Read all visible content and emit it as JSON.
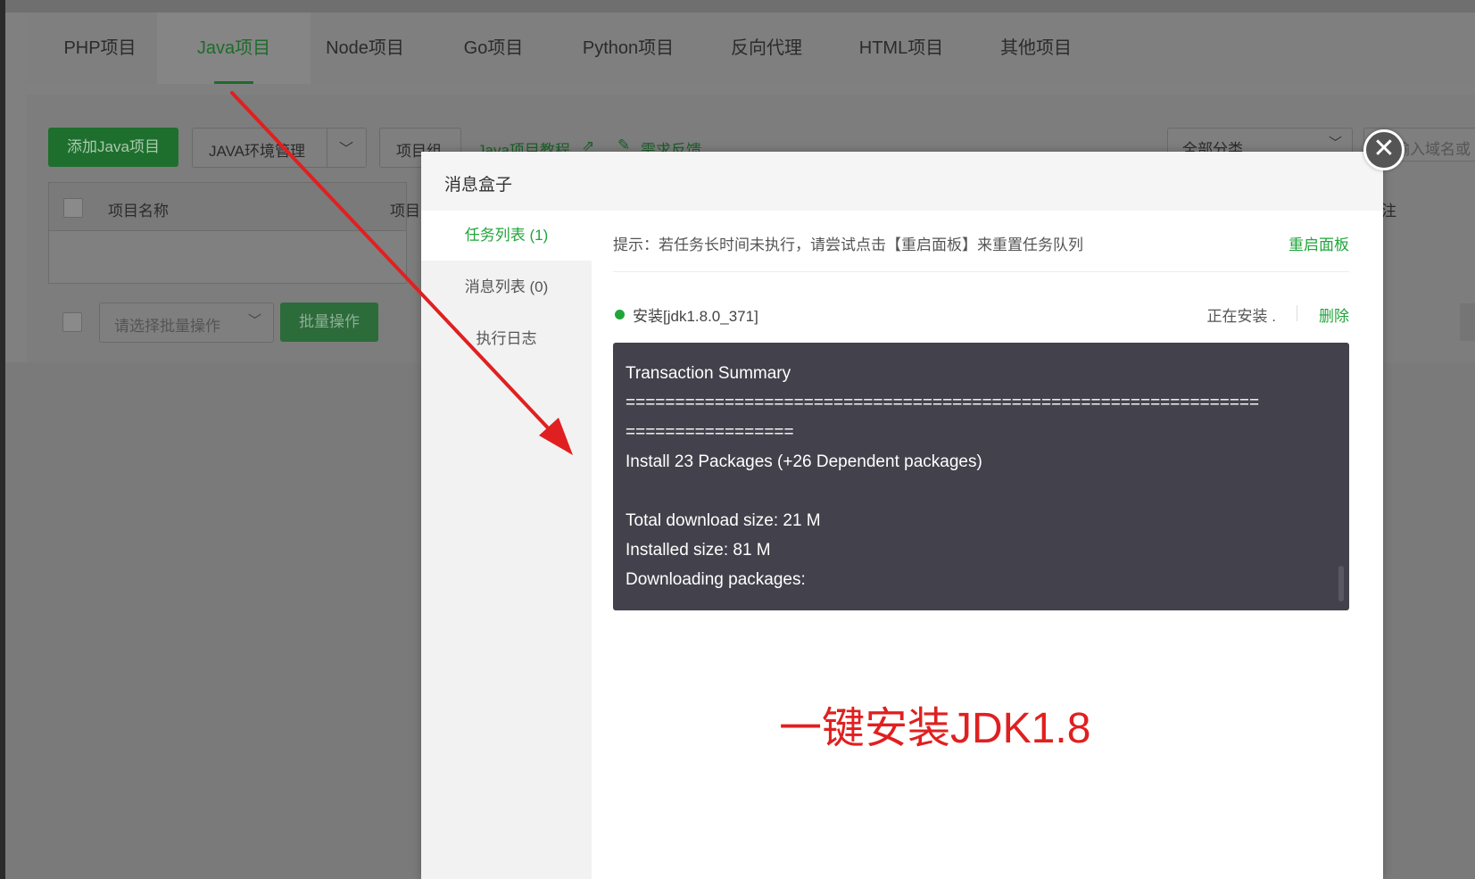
{
  "tabs": [
    {
      "label": "PHP项目",
      "active": false
    },
    {
      "label": "Java项目",
      "active": true
    },
    {
      "label": "Node项目",
      "active": false
    },
    {
      "label": "Go项目",
      "active": false
    },
    {
      "label": "Python项目",
      "active": false
    },
    {
      "label": "反向代理",
      "active": false
    },
    {
      "label": "HTML项目",
      "active": false
    },
    {
      "label": "其他项目",
      "active": false
    }
  ],
  "toolbar": {
    "add_button": "添加Java项目",
    "env_button": "JAVA环境管理",
    "group_button": "项目组",
    "tutorial_link": "Java项目教程",
    "feedback_link": "需求反馈",
    "category_select": "全部分类",
    "search_placeholder": "输入域名或"
  },
  "table": {
    "col_name": "项目名称",
    "col_second": "项目",
    "col_right": "注"
  },
  "batch": {
    "select_placeholder": "请选择批量操作",
    "button": "批量操作"
  },
  "modal": {
    "title": "消息盒子",
    "close_glyph": "✕",
    "side_items": [
      {
        "label": "任务列表 (1)",
        "active": true
      },
      {
        "label": "消息列表 (0)",
        "active": false
      },
      {
        "label": "执行日志",
        "active": false
      }
    ],
    "tip": "提示：若任务长时间未执行，请尝试点击【重启面板】来重置任务队列",
    "restart_link": "重启面板",
    "task": {
      "name": "安装[jdk1.8.0_371]",
      "status": "正在安装 .",
      "delete": "删除"
    },
    "console_lines": [
      "Transaction Summary",
      "================================================================",
      "=================",
      "Install  23 Packages (+26 Dependent packages)",
      "",
      "Total download size: 21 M",
      "Installed size: 81 M",
      "Downloading packages:"
    ]
  },
  "annotation": "一键安装JDK1.8",
  "colors": {
    "accent": "#20a53a",
    "annotation_red": "#e02020",
    "console_bg": "#43414b"
  }
}
